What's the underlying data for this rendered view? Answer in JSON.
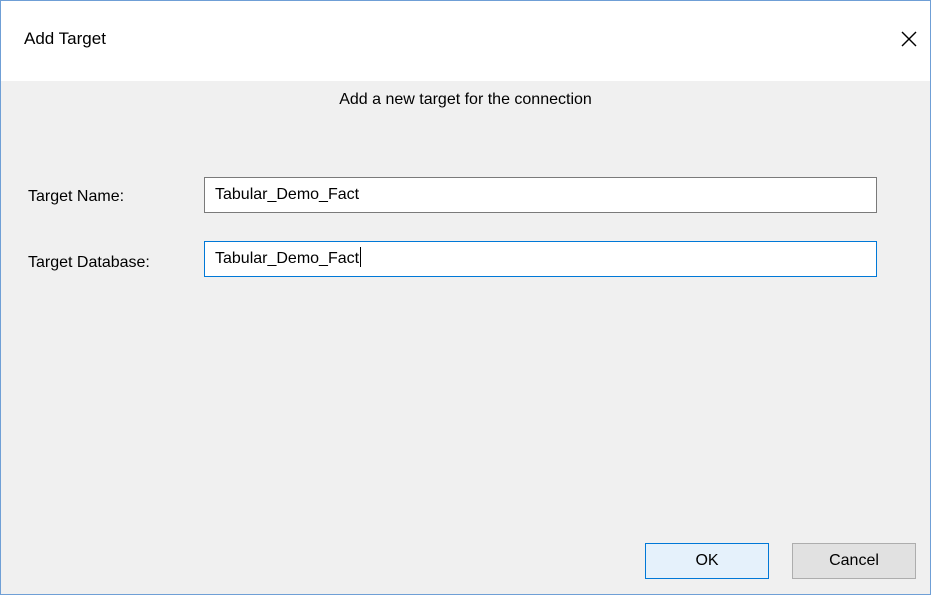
{
  "window": {
    "title": "Add Target"
  },
  "dialog": {
    "header": "Add a new target for the connection",
    "fields": {
      "target_name": {
        "label": "Target Name:",
        "value": "Tabular_Demo_Fact"
      },
      "target_database": {
        "label": "Target Database:",
        "value": "Tabular_Demo_Fact"
      }
    },
    "buttons": {
      "ok": "OK",
      "cancel": "Cancel"
    }
  },
  "icons": {
    "close": "close-icon"
  },
  "colors": {
    "focus_border": "#0078d7",
    "dialog_bg": "#f0f0f0"
  }
}
